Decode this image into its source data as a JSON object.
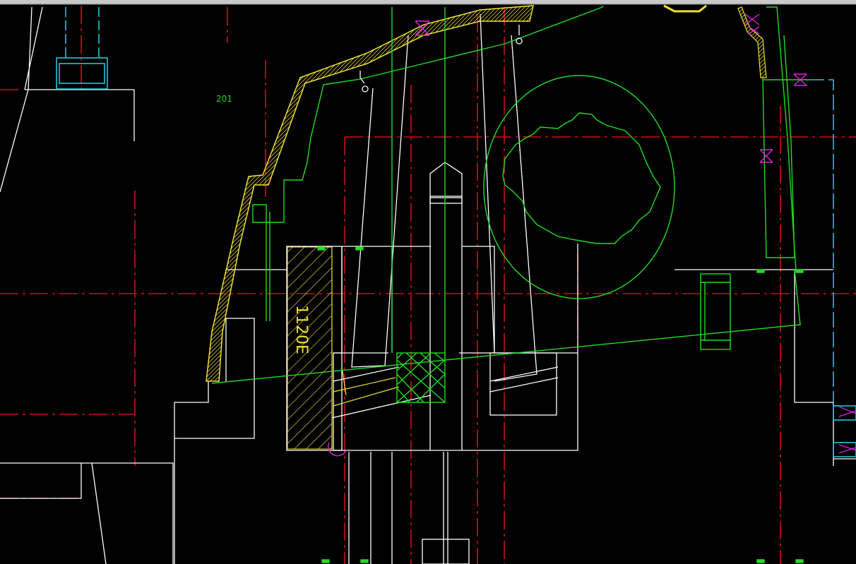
{
  "drawing": {
    "labels": {
      "zone_id": "201",
      "part_mark": "1120E"
    },
    "colors": {
      "background": "#000000",
      "outline": "#ffffff",
      "centerline": "#cc1111",
      "profile": "#22dd22",
      "hatch": "#f0e030",
      "hidden": "#22c6d8",
      "marker": "#dd22dd"
    }
  }
}
